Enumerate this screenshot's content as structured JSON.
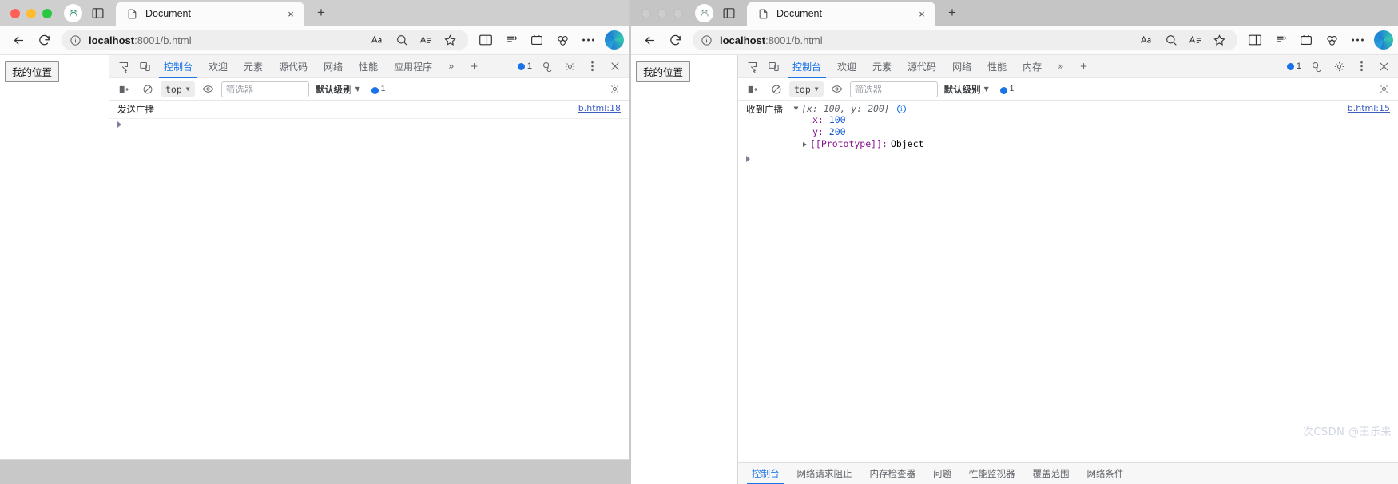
{
  "colors": {
    "accent": "#1a73e8",
    "link": "#3b5fc0",
    "tab_active_underline": "#1a73e8",
    "number_value": "#1155cc",
    "property_key": "#881391",
    "traffic_red": "#ff5f57",
    "traffic_yellow": "#febc2e",
    "traffic_green": "#28c840"
  },
  "left_window": {
    "browser": {
      "tab": {
        "title": "Document",
        "close_label": "×",
        "icon": "page-icon"
      },
      "new_tab_label": "+",
      "url_prefix": "localhost",
      "url_suffix": ":8001/b.html",
      "back_label": "←",
      "reload_label": "↻"
    },
    "page": {
      "button_label": "我的位置"
    },
    "devtools": {
      "tabs": [
        {
          "label": "控制台",
          "active": true
        },
        {
          "label": "欢迎",
          "active": false
        },
        {
          "label": "元素",
          "active": false
        },
        {
          "label": "源代码",
          "active": false
        },
        {
          "label": "网络",
          "active": false
        },
        {
          "label": "性能",
          "active": false
        },
        {
          "label": "应用程序",
          "active": false
        }
      ],
      "more_tabs_label": "»",
      "add_tab_label": "+",
      "error_count": "1",
      "filter_bar": {
        "context": "top",
        "filter_placeholder": "筛选器",
        "level": "默认级别",
        "issue_count": "1"
      },
      "console": {
        "messages": [
          {
            "label": "发送广播",
            "source": "b.html:18"
          }
        ],
        "prompt": ">"
      }
    }
  },
  "right_window": {
    "browser": {
      "tab": {
        "title": "Document",
        "close_label": "×",
        "icon": "page-icon"
      },
      "new_tab_label": "+",
      "url_prefix": "localhost",
      "url_suffix": ":8001/b.html",
      "back_label": "←",
      "reload_label": "↻"
    },
    "page": {
      "button_label": "我的位置"
    },
    "devtools": {
      "tabs": [
        {
          "label": "控制台",
          "active": true
        },
        {
          "label": "欢迎",
          "active": false
        },
        {
          "label": "元素",
          "active": false
        },
        {
          "label": "源代码",
          "active": false
        },
        {
          "label": "网络",
          "active": false
        },
        {
          "label": "性能",
          "active": false
        },
        {
          "label": "内存",
          "active": false
        }
      ],
      "more_tabs_label": "»",
      "add_tab_label": "+",
      "error_count": "1",
      "close_label": "×",
      "filter_bar": {
        "context": "top",
        "filter_placeholder": "筛选器",
        "level": "默认级别",
        "issue_count": "1"
      },
      "console": {
        "message_label": "收到广播",
        "object_preview": "{x: 100, y: 200}",
        "props": [
          {
            "key": "x:",
            "value": "100"
          },
          {
            "key": "y:",
            "value": "200"
          }
        ],
        "prototype_key": "[[Prototype]]:",
        "prototype_value": "Object",
        "source": "b.html:15",
        "prompt": ">"
      },
      "drawer_tabs": [
        {
          "label": "控制台",
          "active": true
        },
        {
          "label": "网络请求阻止",
          "active": false
        },
        {
          "label": "内存检查器",
          "active": false
        },
        {
          "label": "问题",
          "active": false
        },
        {
          "label": "性能监视器",
          "active": false
        },
        {
          "label": "覆盖范围",
          "active": false
        },
        {
          "label": "网络条件",
          "active": false
        }
      ]
    },
    "watermark": "次CSDN @王乐来"
  }
}
